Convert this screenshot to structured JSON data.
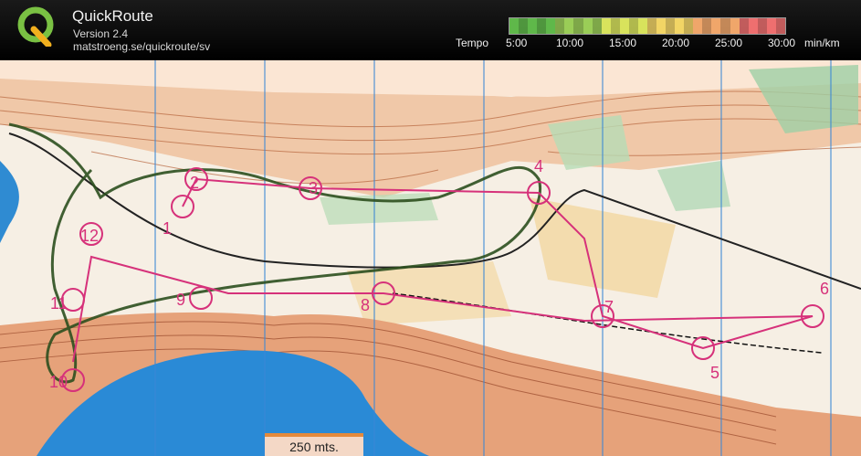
{
  "app": {
    "title": "QuickRoute",
    "version": "Version 2.4",
    "url": "matstroeng.se/quickroute/sv"
  },
  "tempo": {
    "label": "Tempo",
    "ticks": [
      "5:00",
      "10:00",
      "15:00",
      "20:00",
      "25:00",
      "30:00"
    ],
    "unit": "min/km",
    "colors": [
      "#5fb84a",
      "#9acd57",
      "#d8e35c",
      "#f2d565",
      "#f0a66a",
      "#ee6f6f"
    ]
  },
  "map": {
    "controls": [
      "1",
      "2",
      "3",
      "4",
      "5",
      "6",
      "7",
      "8",
      "9",
      "10",
      "11",
      "12"
    ],
    "scale_label": "250 mts."
  }
}
